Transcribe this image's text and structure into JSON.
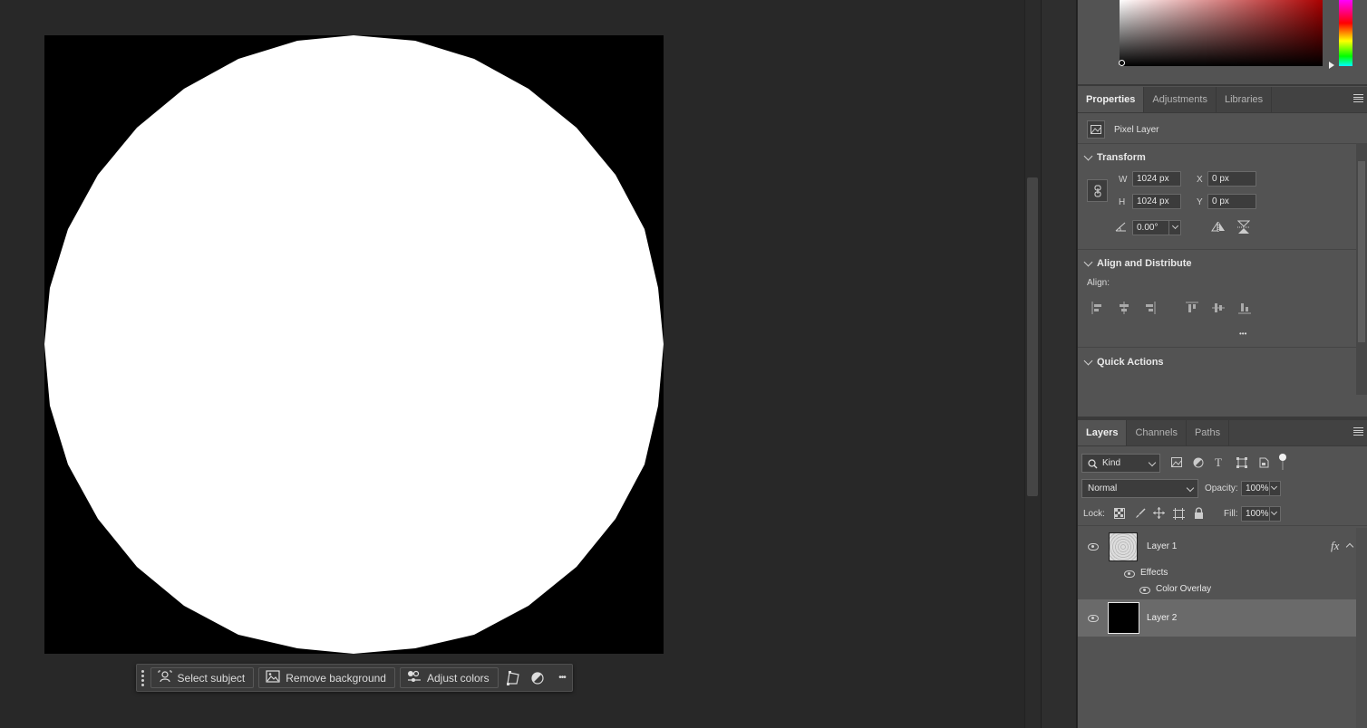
{
  "context_bar": {
    "select_subject": "Select subject",
    "remove_background": "Remove background",
    "adjust_colors": "Adjust colors",
    "more": "•••"
  },
  "properties": {
    "tabs": [
      "Properties",
      "Adjustments",
      "Libraries"
    ],
    "active_tab": "Properties",
    "layer_type": "Pixel Layer",
    "transform": {
      "title": "Transform",
      "w_label": "W",
      "w_value": "1024 px",
      "h_label": "H",
      "h_value": "1024 px",
      "x_label": "X",
      "x_value": "0 px",
      "y_label": "Y",
      "y_value": "0 px",
      "angle_value": "0.00°"
    },
    "align": {
      "title": "Align and Distribute",
      "align_label": "Align:",
      "more": "•••"
    },
    "quick_actions": {
      "title": "Quick Actions"
    }
  },
  "layers_panel": {
    "tabs": [
      "Layers",
      "Channels",
      "Paths"
    ],
    "active_tab": "Layers",
    "filter_kind": "Kind",
    "blend_mode": "Normal",
    "opacity_label": "Opacity:",
    "opacity_value": "100%",
    "lock_label": "Lock:",
    "fill_label": "Fill:",
    "fill_value": "100%",
    "layers": [
      {
        "name": "Layer 1",
        "fx": "fx",
        "effects_label": "Effects",
        "effect": "Color Overlay"
      },
      {
        "name": "Layer 2"
      }
    ]
  },
  "colors": {
    "app_bg": "#282828",
    "panel_bg": "#535353",
    "selected_layer": "#6a6a6a"
  }
}
